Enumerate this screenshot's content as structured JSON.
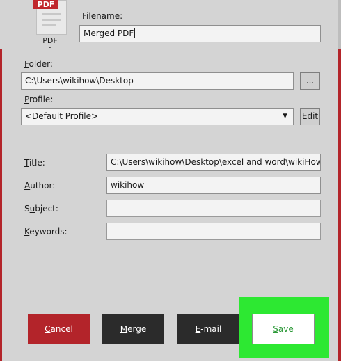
{
  "file_icon": {
    "tag": "PDF",
    "label": "PDF",
    "chevron": "⌄"
  },
  "filename": {
    "label": "Filename:",
    "value": "Merged PDF"
  },
  "folder": {
    "label_mnemonic": "F",
    "label_rest": "older:",
    "value": "C:\\Users\\wikihow\\Desktop",
    "browse_label": "..."
  },
  "profile": {
    "label_mnemonic": "P",
    "label_rest": "rofile:",
    "value": "<Default Profile>",
    "arrow": "▼",
    "edit_label": "Edit"
  },
  "metadata": {
    "title": {
      "label_mnemonic": "T",
      "label_rest": "itle:",
      "value": "C:\\Users\\wikihow\\Desktop\\excel and word\\wikiHow PDF"
    },
    "author": {
      "label_mnemonic": "A",
      "label_rest": "uthor:",
      "value": "wikihow"
    },
    "subject": {
      "label_pre": "S",
      "label_mnemonic": "u",
      "label_rest": "bject:",
      "value": ""
    },
    "keywords": {
      "label_mnemonic": "K",
      "label_rest": "eywords:",
      "value": ""
    }
  },
  "actions": {
    "cancel": {
      "mnemonic": "C",
      "rest": "ancel"
    },
    "merge": {
      "mnemonic": "M",
      "rest": "erge"
    },
    "email": {
      "mnemonic": "E",
      "rest": "-mail"
    },
    "save": {
      "mnemonic": "S",
      "rest": "ave"
    }
  },
  "colors": {
    "accent_red": "#b3242a",
    "highlight_green": "#2de832",
    "dark_button": "#2b2b2b",
    "save_text": "#2e9a3a"
  }
}
